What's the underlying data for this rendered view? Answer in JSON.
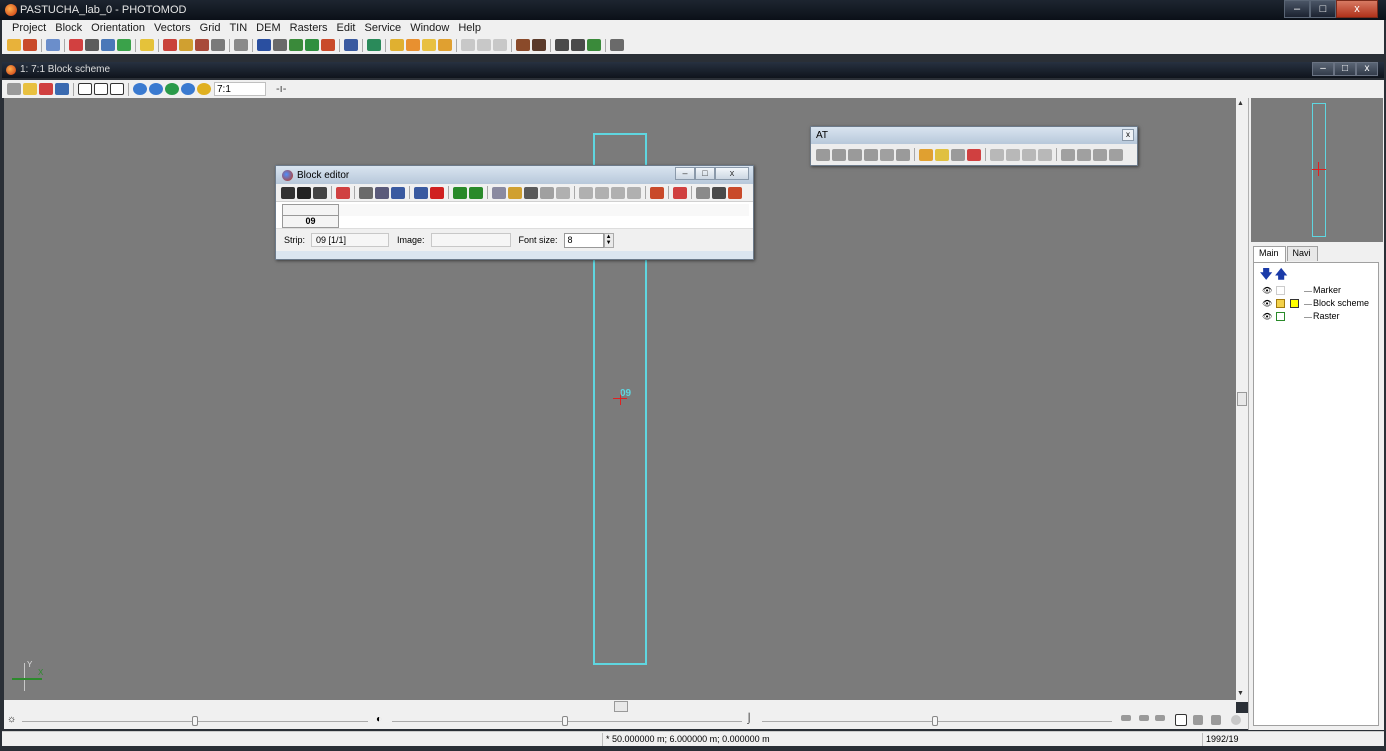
{
  "app": {
    "title": "PASTUCHA_lab_0 - PHOTOMOD",
    "window_buttons": {
      "minimize": "–",
      "maximize": "□",
      "close": "x"
    }
  },
  "menubar": {
    "items": [
      "Project",
      "Block",
      "Orientation",
      "Vectors",
      "Grid",
      "TIN",
      "DEM",
      "Rasters",
      "Edit",
      "Service",
      "Window",
      "Help"
    ]
  },
  "child_window": {
    "title": "1: 7:1 Block scheme",
    "zoom_value": "7:1",
    "pin_icon": "-ı-",
    "window_buttons": {
      "minimize": "–",
      "maximize": "□",
      "close": "x"
    }
  },
  "canvas": {
    "strip_label": "09",
    "axis_y_label": "Y",
    "axis_x_label": "X"
  },
  "block_editor": {
    "title": "Block editor",
    "window_buttons": {
      "minimize": "–",
      "maximize": "□",
      "close": "x"
    },
    "table": {
      "strip_cell": "09"
    },
    "status": {
      "strip_label": "Strip:",
      "strip_value": "09 [1/1]",
      "image_label": "Image:",
      "image_value": "",
      "font_size_label": "Font size:",
      "font_size_value": "8"
    }
  },
  "at_window": {
    "title": "AT",
    "close": "x"
  },
  "right_panel": {
    "tabs": [
      "Main",
      "Navi"
    ],
    "layers": [
      {
        "label": "Marker"
      },
      {
        "label": "Block scheme"
      },
      {
        "label": "Raster"
      }
    ]
  },
  "statusbar": {
    "coords": "* 50.000000 m; 6.000000 m; 0.000000 m",
    "right": "1992/19"
  },
  "colors": {
    "strip": "#5fd6e0",
    "canvas": "#7b7b7b",
    "cross": "#e02020"
  }
}
